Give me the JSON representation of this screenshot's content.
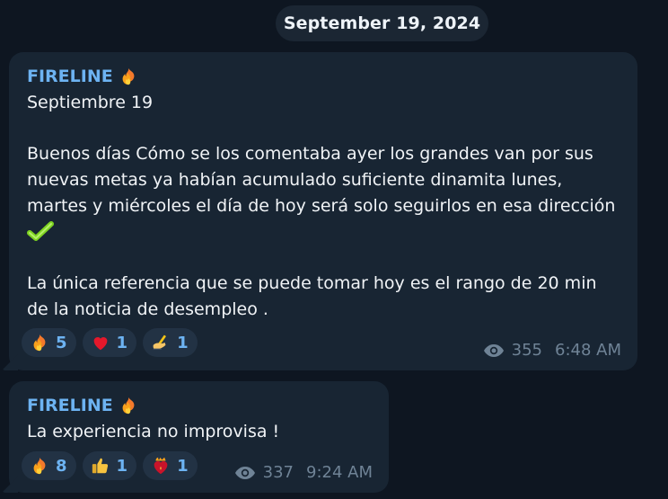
{
  "date_separator": "September 19, 2024",
  "messages": [
    {
      "sender": "FIRELINE",
      "sender_icon": "fire-icon",
      "lines": [
        "Septiembre 19",
        "",
        "Buenos días Cómo se los comentaba ayer los grandes van por sus",
        "nuevas metas ya habían acumulado suficiente dinamita lunes,",
        "martes y miércoles el día de hoy será solo seguirlos en esa dirección"
      ],
      "inline_icon": "check-mark-icon",
      "lines_after": [
        "",
        "La única referencia que se puede tomar hoy es el rango de 20 min",
        "de la noticia de desempleo ."
      ],
      "reactions": [
        {
          "icon": "fire-icon",
          "count": "5"
        },
        {
          "icon": "heart-icon",
          "count": "1"
        },
        {
          "icon": "writing-hand-icon",
          "count": "1"
        }
      ],
      "views": "355",
      "time": "6:48 AM"
    },
    {
      "sender": "FIRELINE",
      "sender_icon": "fire-icon",
      "lines": [
        "La experiencia no improvisa !"
      ],
      "reactions": [
        {
          "icon": "fire-icon",
          "count": "8"
        },
        {
          "icon": "thumbs-up-icon",
          "count": "1"
        },
        {
          "icon": "heart-on-fire-icon",
          "count": "1"
        }
      ],
      "views": "337",
      "time": "9:24 AM"
    }
  ]
}
